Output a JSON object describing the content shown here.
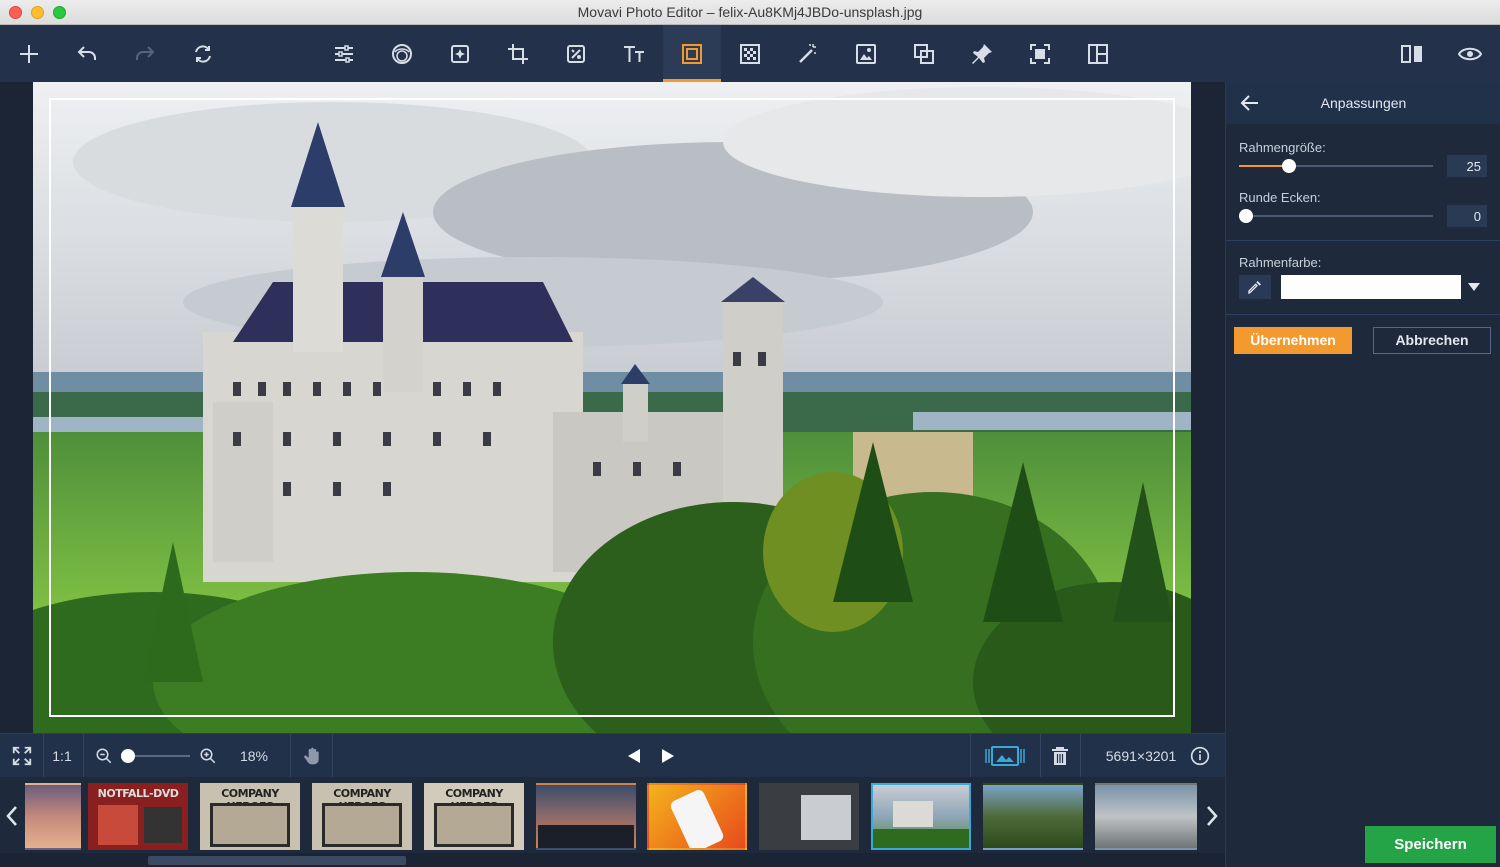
{
  "window": {
    "title": "Movavi Photo Editor – felix-Au8KMj4JBDo-unsplash.jpg"
  },
  "toolbar": {
    "left_tools": [
      "add-icon",
      "undo-icon",
      "redo-icon",
      "rotate-icon"
    ],
    "center_tools": [
      "adjust-icon",
      "filters-icon",
      "retouch-icon",
      "crop-icon",
      "object-removal-icon",
      "text-icon",
      "frame-icon",
      "background-icon",
      "magic-wand-icon",
      "replace-background-icon",
      "clone-icon",
      "pin-icon",
      "resize-icon",
      "layout-icon"
    ],
    "active_tool": "frame-icon",
    "right_tools": [
      "compare-icon",
      "preview-icon"
    ]
  },
  "panel": {
    "title": "Anpassungen",
    "frame_size_label": "Rahmengröße:",
    "frame_size_value": "25",
    "frame_size_fraction": 0.26,
    "round_corners_label": "Runde Ecken:",
    "round_corners_value": "0",
    "round_corners_fraction": 0.0,
    "frame_color_label": "Rahmenfarbe:",
    "frame_color": "#ffffff",
    "apply_label": "Übernehmen",
    "cancel_label": "Abbrechen",
    "save_label": "Speichern"
  },
  "bottombar": {
    "ratio_label": "1:1",
    "zoom_label": "18%",
    "zoom_fraction": 0.05,
    "dimensions": "5691×3201"
  },
  "filmstrip": {
    "thumbnails": [
      {
        "caption": ""
      },
      {
        "caption": "NOTFALL-DVD"
      },
      {
        "caption": "COMPANY HEROES"
      },
      {
        "caption": "COMPANY HEROES"
      },
      {
        "caption": "COMPANY HEROES"
      },
      {
        "caption": ""
      },
      {
        "caption": ""
      },
      {
        "caption": ""
      },
      {
        "caption": ""
      },
      {
        "caption": ""
      },
      {
        "caption": ""
      }
    ],
    "selected_index": 8
  },
  "colors": {
    "accent": "#f29a2e",
    "save": "#24a347",
    "selection": "#3aa8d8"
  }
}
